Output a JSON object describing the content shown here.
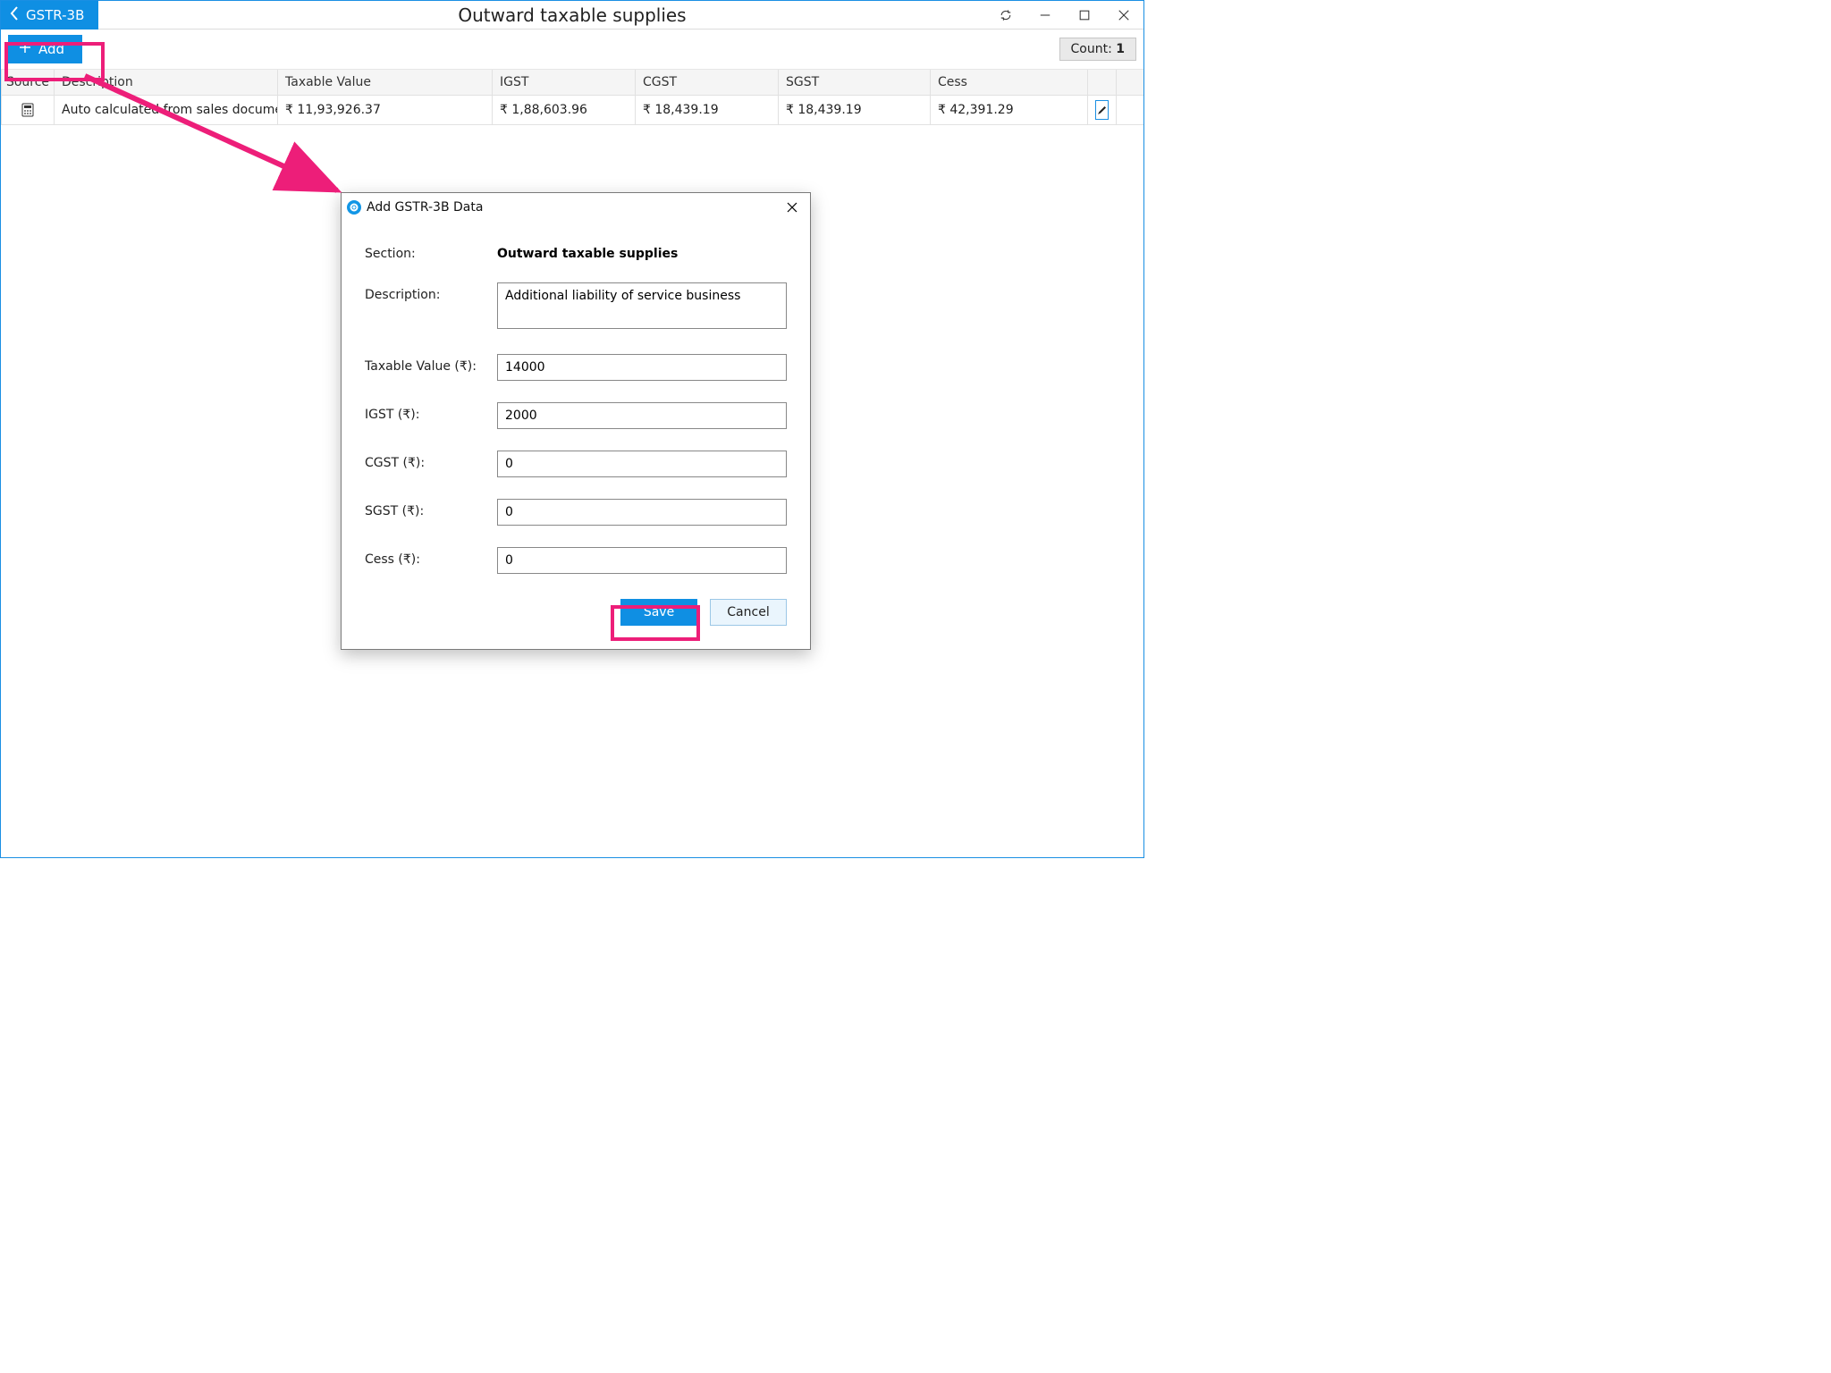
{
  "header": {
    "back_label": "GSTR-3B",
    "title": "Outward taxable supplies"
  },
  "toolbar": {
    "add_label": "Add",
    "count_label": "Count: ",
    "count_value": "1"
  },
  "grid": {
    "columns": {
      "source": "Source",
      "description": "Description",
      "taxable_value": "Taxable Value",
      "igst": "IGST",
      "cgst": "CGST",
      "sgst": "SGST",
      "cess": "Cess"
    },
    "rows": [
      {
        "description": "Auto calculated from sales docume",
        "taxable_value": "₹ 11,93,926.37",
        "igst": "₹ 1,88,603.96",
        "cgst": "₹ 18,439.19",
        "sgst": "₹ 18,439.19",
        "cess": "₹ 42,391.29"
      }
    ]
  },
  "dialog": {
    "title": "Add GSTR-3B Data",
    "labels": {
      "section": "Section:",
      "description": "Description:",
      "taxable_value": "Taxable Value (₹):",
      "igst": "IGST (₹):",
      "cgst": "CGST (₹):",
      "sgst": "SGST (₹):",
      "cess": "Cess (₹):"
    },
    "section_value": "Outward taxable supplies",
    "values": {
      "description": "Additional liability of service business",
      "taxable_value": "14000",
      "igst": "2000",
      "cgst": "0",
      "sgst": "0",
      "cess": "0"
    },
    "buttons": {
      "save": "Save",
      "cancel": "Cancel"
    }
  }
}
